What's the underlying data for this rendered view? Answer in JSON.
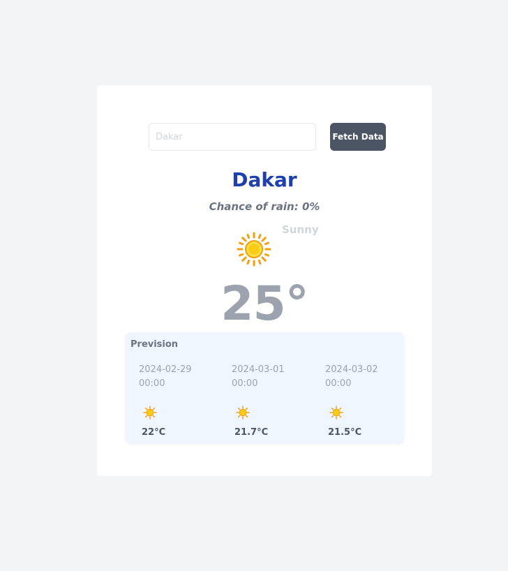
{
  "search": {
    "placeholder": "Dakar",
    "value": ""
  },
  "fetch_button_label": "Fetch Data",
  "city": "Dakar",
  "rain_text": "Chance of rain: 0%",
  "condition": "Sunny",
  "temperature": "25°",
  "weather_icon": "sun-icon",
  "colors": {
    "accent": "#1e40af",
    "button": "#4b5563",
    "forecast_bg": "#eff6ff",
    "sun": "#facc15"
  },
  "forecast": {
    "title": "Prevision",
    "days": [
      {
        "date": "2024-02-29 00:00",
        "icon": "sun-icon",
        "temp": "22°C"
      },
      {
        "date": "2024-03-01 00:00",
        "icon": "sun-icon",
        "temp": "21.7°C"
      },
      {
        "date": "2024-03-02 00:00",
        "icon": "sun-icon",
        "temp": "21.5°C"
      }
    ]
  }
}
